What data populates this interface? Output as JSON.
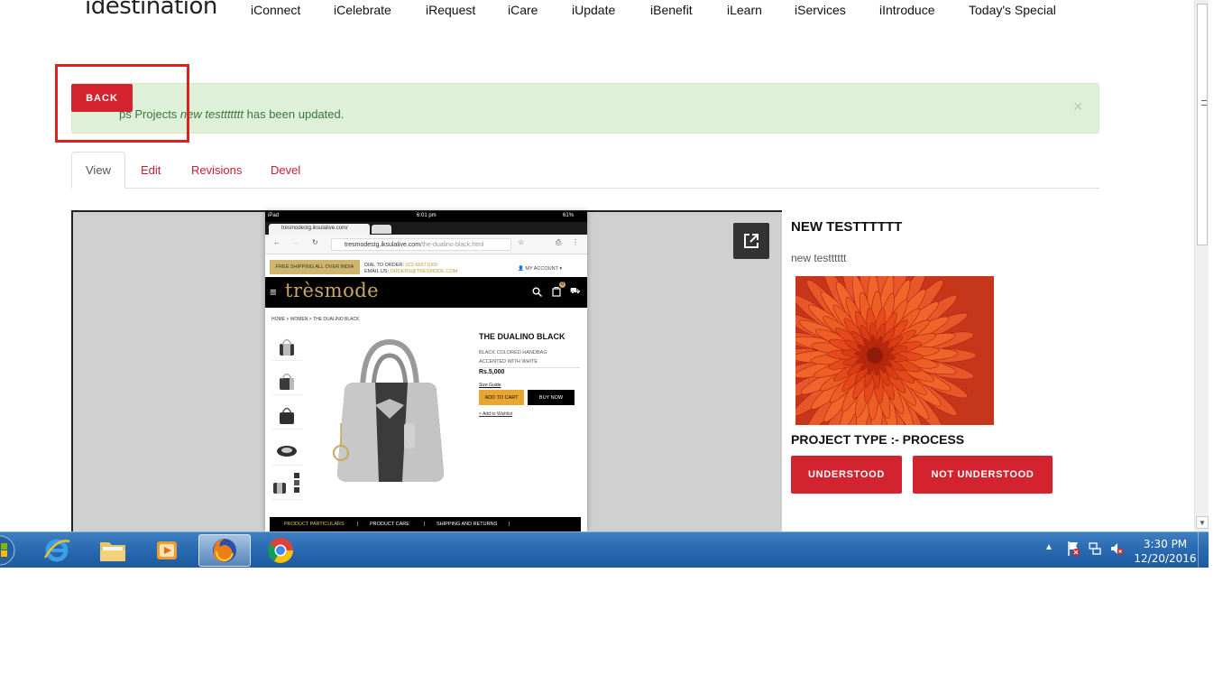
{
  "site": {
    "logo": "idestination"
  },
  "nav": [
    {
      "label": "iConnect"
    },
    {
      "label": "iCelebrate"
    },
    {
      "label": "iRequest"
    },
    {
      "label": "iCare"
    },
    {
      "label": "iUpdate"
    },
    {
      "label": "iBenefit"
    },
    {
      "label": "iLearn"
    },
    {
      "label": "iServices"
    },
    {
      "label": "iIntroduce"
    },
    {
      "label": "Today's Special"
    }
  ],
  "status": {
    "prefix": "ps Projects ",
    "item": "new testtttttt",
    "suffix": " has been updated.",
    "close": "×"
  },
  "back_button": "BACK",
  "tabs": [
    {
      "label": "View",
      "active": true
    },
    {
      "label": "Edit"
    },
    {
      "label": "Revisions"
    },
    {
      "label": "Devel"
    }
  ],
  "screenshot": {
    "status_left": "iPad",
    "status_time": "6:01 pm",
    "status_right": "61%",
    "tab_title": "tresmodestg.iksulalive.com/",
    "url_host": "tresmodestg.iksulalive.com",
    "url_path": "/the-dualino-black.html",
    "promo": "FREE SHIPPING ALL OVER INDIA",
    "dial_label": "DIAL TO ORDER:",
    "dial_number": "022-66671000",
    "email_label": "EMAIL US:",
    "email": "ORDERS@TRESMODE.COM",
    "account": "MY ACCOUNT",
    "brand": "trèsmode",
    "cart_count": "0",
    "breadcrumb": "HOME  >  WOMEN  >  THE DUALINO BLACK",
    "product_title": "THE DUALINO BLACK",
    "product_desc_1": "BLACK COLORED HANDBAG",
    "product_desc_2": "ACCENTED WITH WHITE",
    "price": "Rs.5,000",
    "size_guide": "Size Guide",
    "add_to_cart": "ADD TO CART",
    "buy_now": "BUY NOW",
    "wishlist": "Add to Wishlist",
    "footer_tabs": [
      "PRODUCT PARTICULARS",
      "PRODUCT CARE",
      "SHIPPING AND RETURNS"
    ]
  },
  "node": {
    "title": "NEW TESTTTTTT",
    "body": "new testttttt",
    "project_type": "PROJECT TYPE :- PROCESS",
    "understood": "UNDERSTOOD",
    "not_understood": "NOT UNDERSTOOD"
  },
  "taskbar": {
    "time": "3:30 PM",
    "date": "12/20/2016"
  },
  "colors": {
    "brand_red": "#d3232f",
    "success_bg": "#dff0d8",
    "success_text": "#3c763d",
    "taskbar": "#2a6bb1"
  }
}
